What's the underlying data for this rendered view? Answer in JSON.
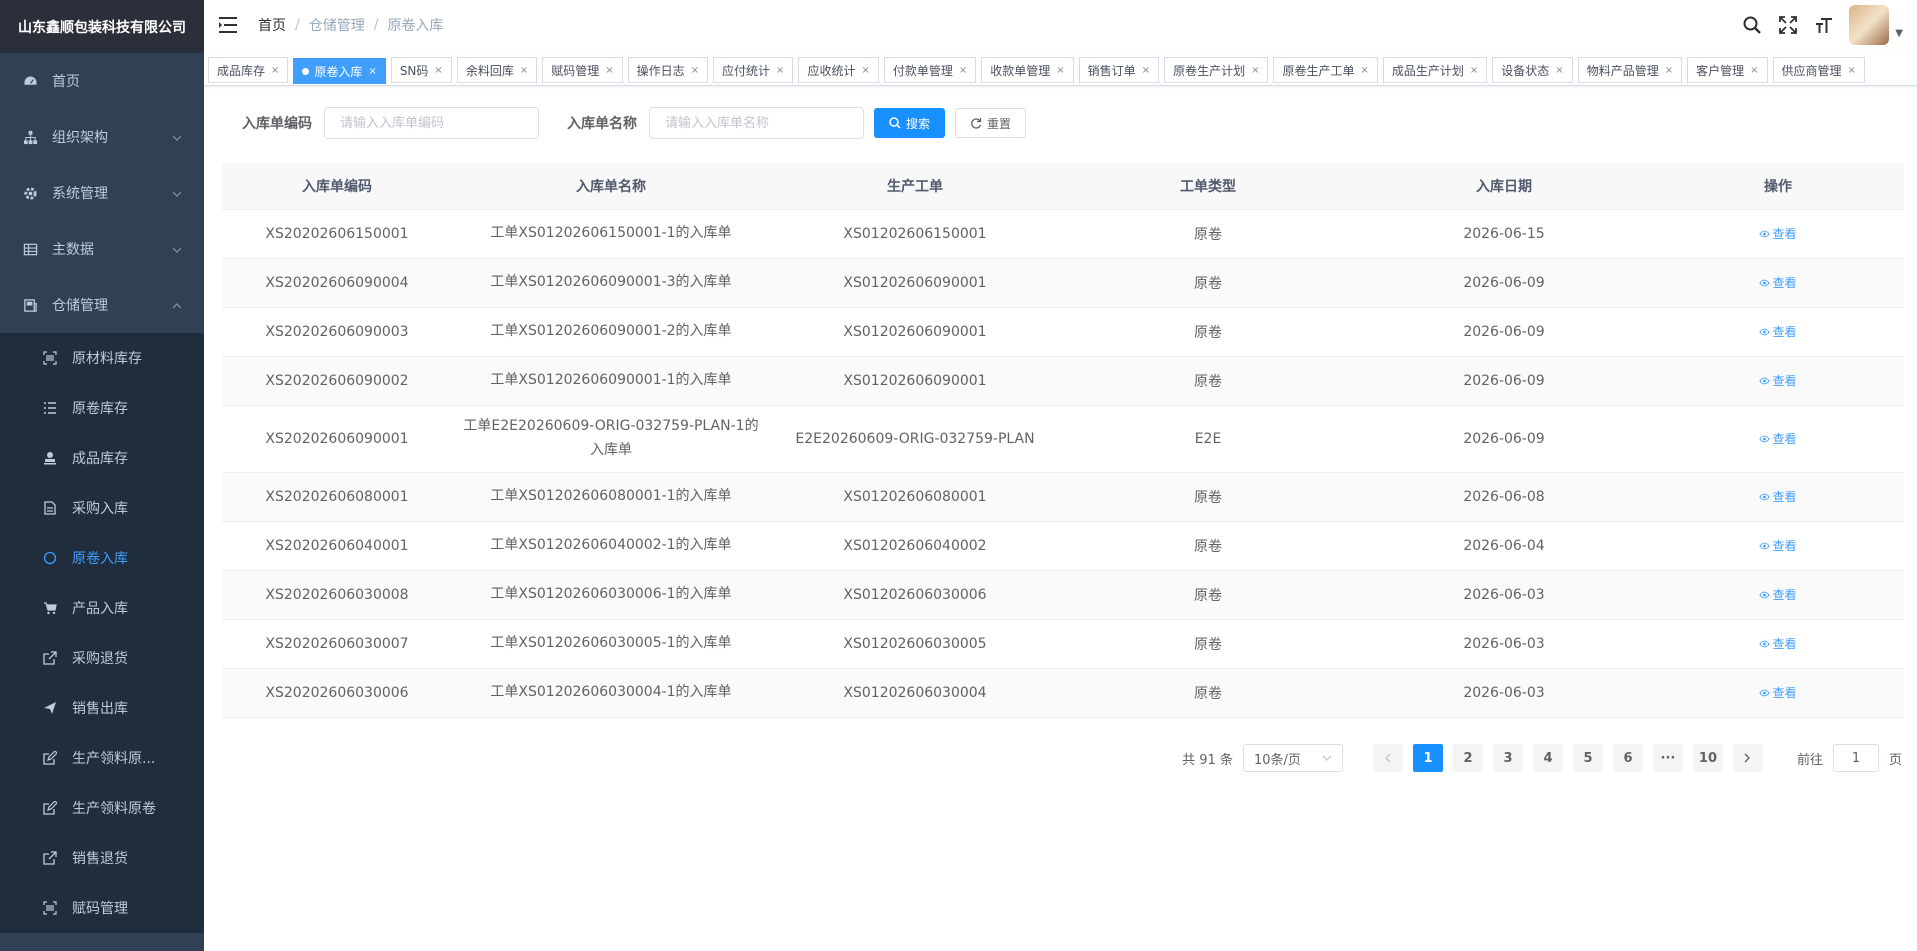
{
  "sidebar": {
    "brand": "山东鑫顺包装科技有限公司",
    "menu": [
      {
        "label": "首页",
        "icon": "dashboard-icon",
        "expandable": false
      },
      {
        "label": "组织架构",
        "icon": "org-tree-icon",
        "expandable": true
      },
      {
        "label": "系统管理",
        "icon": "gear-icon",
        "expandable": true
      },
      {
        "label": "主数据",
        "icon": "table-grid-icon",
        "expandable": true
      },
      {
        "label": "仓储管理",
        "icon": "warehouse-icon",
        "expandable": true,
        "expanded": true
      }
    ],
    "submenu": [
      {
        "label": "原材料库存",
        "icon": "barcode-icon"
      },
      {
        "label": "原卷库存",
        "icon": "list-icon"
      },
      {
        "label": "成品库存",
        "icon": "stamp-icon"
      },
      {
        "label": "采购入库",
        "icon": "document-icon"
      },
      {
        "label": "原卷入库",
        "icon": "circle-icon",
        "active": true
      },
      {
        "label": "产品入库",
        "icon": "cart-icon"
      },
      {
        "label": "采购退货",
        "icon": "external-link-icon"
      },
      {
        "label": "销售出库",
        "icon": "send-icon"
      },
      {
        "label": "生产领料原...",
        "icon": "edit-icon"
      },
      {
        "label": "生产领料原卷",
        "icon": "edit-icon"
      },
      {
        "label": "销售退货",
        "icon": "external-link-icon"
      },
      {
        "label": "赋码管理",
        "icon": "barcode-icon"
      }
    ]
  },
  "header": {
    "breadcrumb": [
      "首页",
      "仓储管理",
      "原卷入库"
    ]
  },
  "tags": [
    {
      "label": "成品库存",
      "active": false
    },
    {
      "label": "原卷入库",
      "active": true
    },
    {
      "label": "SN码",
      "active": false
    },
    {
      "label": "余料回库",
      "active": false
    },
    {
      "label": "赋码管理",
      "active": false
    },
    {
      "label": "操作日志",
      "active": false
    },
    {
      "label": "应付统计",
      "active": false
    },
    {
      "label": "应收统计",
      "active": false
    },
    {
      "label": "付款单管理",
      "active": false
    },
    {
      "label": "收款单管理",
      "active": false
    },
    {
      "label": "销售订单",
      "active": false
    },
    {
      "label": "原卷生产计划",
      "active": false
    },
    {
      "label": "原卷生产工单",
      "active": false
    },
    {
      "label": "成品生产计划",
      "active": false
    },
    {
      "label": "设备状态",
      "active": false
    },
    {
      "label": "物料产品管理",
      "active": false
    },
    {
      "label": "客户管理",
      "active": false
    },
    {
      "label": "供应商管理",
      "active": false
    }
  ],
  "search": {
    "code_label": "入库单编码",
    "code_placeholder": "请输入入库单编码",
    "name_label": "入库单名称",
    "name_placeholder": "请输入入库单名称",
    "search_button": "搜索",
    "reset_button": "重置"
  },
  "table": {
    "columns": [
      "入库单编码",
      "入库单名称",
      "生产工单",
      "工单类型",
      "入库日期",
      "操作"
    ],
    "action_label": "查看",
    "rows": [
      {
        "code": "XS20202606150001",
        "name": "工单XS01202606150001-1的入库单",
        "order": "XS01202606150001",
        "type": "原卷",
        "date": "2026-06-15"
      },
      {
        "code": "XS20202606090004",
        "name": "工单XS01202606090001-3的入库单",
        "order": "XS01202606090001",
        "type": "原卷",
        "date": "2026-06-09"
      },
      {
        "code": "XS20202606090003",
        "name": "工单XS01202606090001-2的入库单",
        "order": "XS01202606090001",
        "type": "原卷",
        "date": "2026-06-09"
      },
      {
        "code": "XS20202606090002",
        "name": "工单XS01202606090001-1的入库单",
        "order": "XS01202606090001",
        "type": "原卷",
        "date": "2026-06-09"
      },
      {
        "code": "XS20202606090001",
        "name": "工单E2E20260609-ORIG-032759-PLAN-1的入库单",
        "order": "E2E20260609-ORIG-032759-PLAN",
        "type": "E2E",
        "date": "2026-06-09",
        "tall": true
      },
      {
        "code": "XS20202606080001",
        "name": "工单XS01202606080001-1的入库单",
        "order": "XS01202606080001",
        "type": "原卷",
        "date": "2026-06-08"
      },
      {
        "code": "XS20202606040001",
        "name": "工单XS01202606040002-1的入库单",
        "order": "XS01202606040002",
        "type": "原卷",
        "date": "2026-06-04"
      },
      {
        "code": "XS20202606030008",
        "name": "工单XS01202606030006-1的入库单",
        "order": "XS01202606030006",
        "type": "原卷",
        "date": "2026-06-03"
      },
      {
        "code": "XS20202606030007",
        "name": "工单XS01202606030005-1的入库单",
        "order": "XS01202606030005",
        "type": "原卷",
        "date": "2026-06-03"
      },
      {
        "code": "XS20202606030006",
        "name": "工单XS01202606030004-1的入库单",
        "order": "XS01202606030004",
        "type": "原卷",
        "date": "2026-06-03"
      }
    ]
  },
  "pagination": {
    "total_text": "共 91 条",
    "page_size": "10条/页",
    "pages": [
      "1",
      "2",
      "3",
      "4",
      "5",
      "6",
      "···",
      "10"
    ],
    "current": "1",
    "goto_label": "前往",
    "goto_value": "1",
    "page_suffix": "页"
  },
  "colors": {
    "sidebar_bg": "#304156",
    "brand_bg": "#2b2f3a",
    "accent": "#1890ff",
    "active_text": "#409eff"
  }
}
